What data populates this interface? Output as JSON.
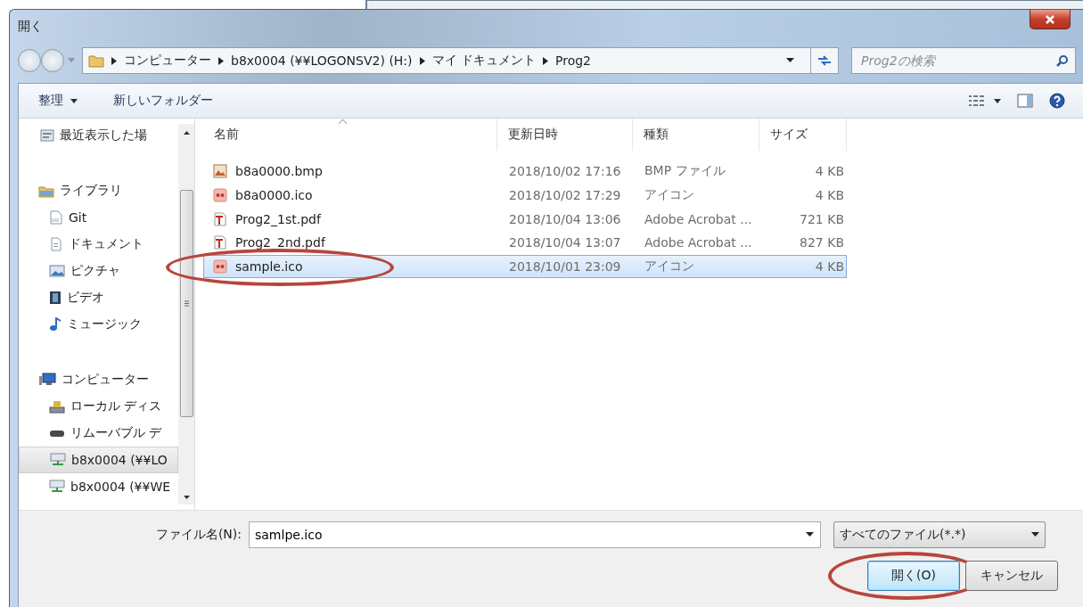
{
  "window": {
    "title": "開く"
  },
  "navigation": {
    "path": [
      "コンピューター",
      "b8x0004 (¥¥LOGONSV2) (H:)",
      "マイ ドキュメント",
      "Prog2"
    ],
    "search": {
      "placeholder": "Prog2の検索"
    }
  },
  "toolbar": {
    "buttons": [
      {
        "label": "整理",
        "kind": "menu"
      },
      {
        "label": "新しいフォルダー",
        "kind": "plain"
      }
    ]
  },
  "sidebar": {
    "items": [
      {
        "label": "最近表示した場",
        "kind": "recent",
        "selected": false
      },
      {
        "label": "ライブラリ",
        "kind": "library",
        "selected": false,
        "children": [
          {
            "label": "Git",
            "kind": "gitlib",
            "selected": false
          },
          {
            "label": "ドキュメント",
            "kind": "document",
            "selected": false
          },
          {
            "label": "ピクチャ",
            "kind": "pictures",
            "selected": false
          },
          {
            "label": "ビデオ",
            "kind": "video",
            "selected": false
          },
          {
            "label": "ミュージック",
            "kind": "music",
            "selected": false
          }
        ]
      },
      {
        "label": "コンピューター",
        "kind": "computer",
        "selected": false,
        "children": [
          {
            "label": "ローカル ディス",
            "kind": "disk",
            "selected": false
          },
          {
            "label": "リムーバブル デ",
            "kind": "removable",
            "selected": false
          },
          {
            "label": "b8x0004 (¥¥LO",
            "kind": "network",
            "selected": true
          },
          {
            "label": "b8x0004 (¥¥WE",
            "kind": "network",
            "selected": false
          }
        ]
      }
    ]
  },
  "file_list": {
    "columns": [
      {
        "label": "名前",
        "sorted": true
      },
      {
        "label": "更新日時",
        "sorted": false
      },
      {
        "label": "種類",
        "sorted": false
      },
      {
        "label": "サイズ",
        "sorted": false
      }
    ],
    "rows": [
      {
        "name": "b8a0000.bmp",
        "modified": "2018/10/02 17:16",
        "type": "BMP ファイル",
        "size": "4 KB",
        "kind": "image",
        "selected": false,
        "circled": false
      },
      {
        "name": "b8a0000.ico",
        "modified": "2018/10/02 17:29",
        "type": "アイコン",
        "size": "4 KB",
        "kind": "icon",
        "selected": false,
        "circled": false
      },
      {
        "name": "Prog2_1st.pdf",
        "modified": "2018/10/04 13:06",
        "type": "Adobe Acrobat ...",
        "size": "721 KB",
        "kind": "pdf",
        "selected": false,
        "circled": false
      },
      {
        "name": "Prog2_2nd.pdf",
        "modified": "2018/10/04 13:07",
        "type": "Adobe Acrobat ...",
        "size": "827 KB",
        "kind": "pdf",
        "selected": false,
        "circled": false
      },
      {
        "name": "sample.ico",
        "modified": "2018/10/01 23:09",
        "type": "アイコン",
        "size": "4 KB",
        "kind": "icon",
        "selected": true,
        "circled": true
      }
    ]
  },
  "footer": {
    "filename_label": "ファイル名(N):",
    "filename": "samlpe.ico",
    "filter": "すべてのファイル(*.*)",
    "buttons": [
      {
        "label": "開く(O)",
        "default": true,
        "circled": true
      },
      {
        "label": "キャンセル",
        "default": false,
        "circled": false
      }
    ]
  }
}
